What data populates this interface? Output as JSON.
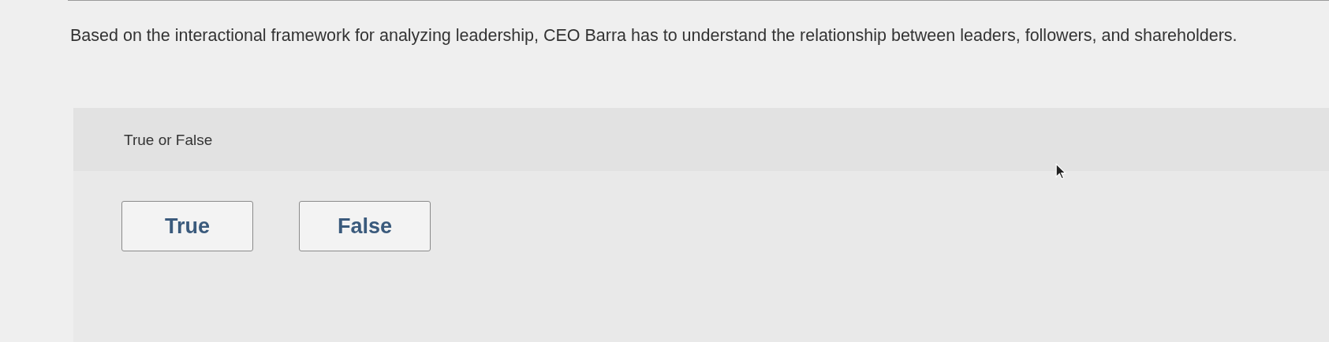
{
  "question": "Based on the interactional framework for analyzing leadership, CEO Barra has to understand the relationship between leaders, followers, and shareholders.",
  "prompt": "True or False",
  "options": [
    {
      "label": "True",
      "selected": false
    },
    {
      "label": "False",
      "selected": false
    }
  ]
}
